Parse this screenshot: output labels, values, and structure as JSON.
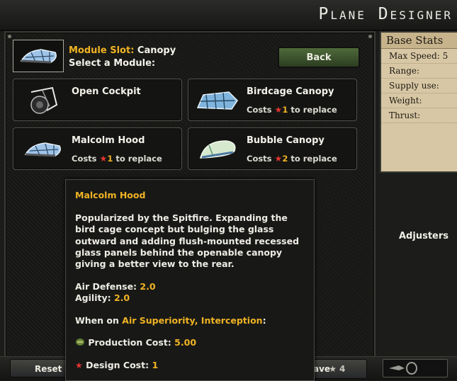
{
  "window": {
    "title": "Plane Designer"
  },
  "module_slot": {
    "label": "Module Slot:",
    "value": "Canopy",
    "prompt": "Select a Module:"
  },
  "back_button": {
    "label": "Back"
  },
  "options": [
    {
      "name": "Open Cockpit",
      "cost_prefix": "",
      "cost_value": "",
      "cost_suffix": "",
      "icon": "open-cockpit-icon"
    },
    {
      "name": "Birdcage Canopy",
      "cost_prefix": "Costs",
      "cost_value": "1",
      "cost_suffix": "to replace",
      "icon": "birdcage-canopy-icon"
    },
    {
      "name": "Malcolm Hood",
      "cost_prefix": "Costs",
      "cost_value": "1",
      "cost_suffix": "to replace",
      "icon": "malcolm-hood-icon"
    },
    {
      "name": "Bubble Canopy",
      "cost_prefix": "Costs",
      "cost_value": "2",
      "cost_suffix": "to replace",
      "icon": "bubble-canopy-icon"
    }
  ],
  "base_stats": {
    "title": "Base Stats",
    "rows": [
      "Max Speed: 5",
      "Range:",
      "Supply use:",
      "Weight:",
      "Thrust:"
    ]
  },
  "adjusters": {
    "label": "Adjusters"
  },
  "bottom": {
    "reset_label": "Reset",
    "save_label": "ave",
    "save_cost": "4"
  },
  "tooltip": {
    "title": "Malcolm Hood",
    "description": "Popularized by the Spitfire.  Expanding the bird cage concept but bulging the glass outward and adding flush-mounted recessed glass panels behind the openable canopy giving a better view to the rear.",
    "air_defense_label": "Air Defense:",
    "air_defense_value": "2.0",
    "agility_label": "Agility:",
    "agility_value": "2.0",
    "when_on_label": "When on",
    "when_on_value": "Air Superiority, Interception",
    "when_on_colon": ":",
    "production_cost_label": "Production Cost:",
    "production_cost_value": "5.00",
    "design_cost_label": "Design Cost:",
    "design_cost_value": "1"
  },
  "colors": {
    "accent_gold": "#f0b323",
    "star_red": "#e3342f",
    "button_green": "#4f6a3a"
  }
}
